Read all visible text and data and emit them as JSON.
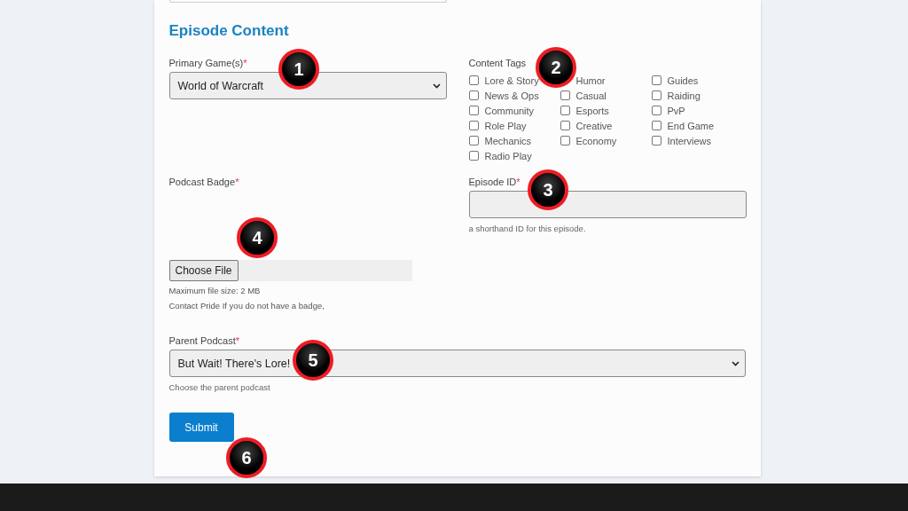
{
  "section_title": "Episode Content",
  "primary_game": {
    "label": "Primary Game(s)",
    "required_mark": "*",
    "value": "World of Warcraft"
  },
  "content_tags": {
    "label": "Content Tags",
    "columns": [
      [
        {
          "label": "Lore & Story",
          "checked": false
        },
        {
          "label": "News & Ops",
          "checked": false
        },
        {
          "label": "Community",
          "checked": false
        },
        {
          "label": "Role Play",
          "checked": false
        },
        {
          "label": "Mechanics",
          "checked": false
        },
        {
          "label": "Radio Play",
          "checked": false
        }
      ],
      [
        {
          "label": "Humor"
        },
        {
          "label": "Casual",
          "checked": false
        },
        {
          "label": "Esports",
          "checked": false
        },
        {
          "label": "Creative",
          "checked": false
        },
        {
          "label": "Economy",
          "checked": false
        }
      ],
      [
        {
          "label": "Guides",
          "checked": false
        },
        {
          "label": "Raiding",
          "checked": false
        },
        {
          "label": "PvP",
          "checked": false
        },
        {
          "label": "End Game",
          "checked": false
        },
        {
          "label": "Interviews",
          "checked": false
        }
      ]
    ]
  },
  "podcast_badge": {
    "label": "Podcast Badge",
    "required_mark": "*",
    "button": "Choose File",
    "notes": [
      "Maximum file size: 2 MB",
      "Contact Pride If you do not have a badge,"
    ]
  },
  "episode_id": {
    "label": "Episode ID",
    "required_mark": "*",
    "hint": "a shorthand ID for this episode."
  },
  "parent_podcast": {
    "label": "Parent Podcast",
    "required_mark": "*",
    "value": "But Wait! There's Lore!",
    "hint": "Choose the parent podcast"
  },
  "submit": "Submit",
  "markers": [
    "1",
    "2",
    "3",
    "4",
    "5",
    "6"
  ]
}
